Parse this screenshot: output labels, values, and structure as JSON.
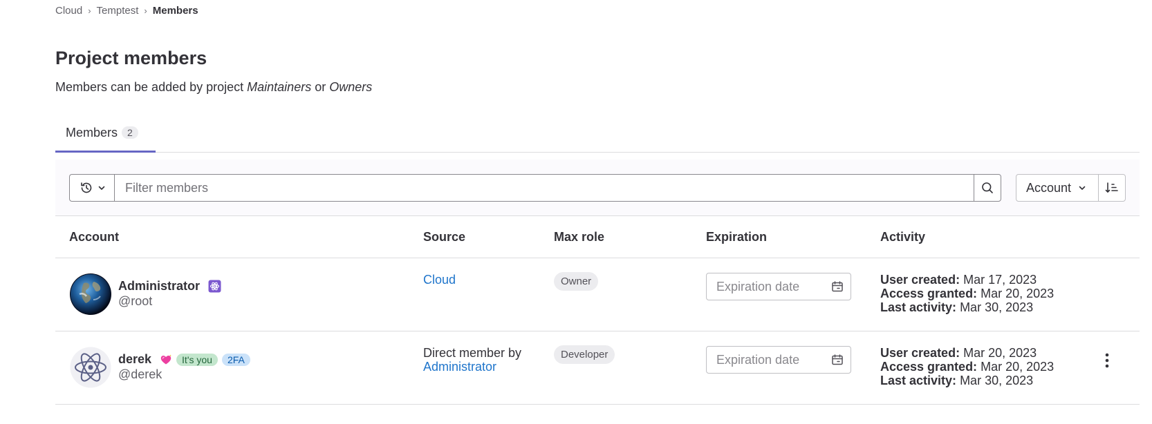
{
  "breadcrumb": {
    "items": [
      "Cloud",
      "Temptest",
      "Members"
    ],
    "separator": "›"
  },
  "page": {
    "title": "Project members",
    "description_prefix": "Members can be added by project ",
    "role_maintainers": "Maintainers",
    "description_or": " or ",
    "role_owners": "Owners"
  },
  "tabs": [
    {
      "label": "Members",
      "count": "2",
      "active": true
    }
  ],
  "filter": {
    "history_icon": "history-icon",
    "placeholder": "Filter members",
    "search_icon": "search-icon",
    "sort_label": "Account",
    "sort_direction_icon": "sort-ascending-icon"
  },
  "table": {
    "headers": {
      "account": "Account",
      "source": "Source",
      "max_role": "Max role",
      "expiration": "Expiration",
      "activity": "Activity"
    },
    "rows": [
      {
        "name": "Administrator",
        "username": "@root",
        "badge_icon": "admin-icon",
        "source": "Cloud",
        "max_role": "Owner",
        "expiration_placeholder": "Expiration date",
        "user_created_label": "User created:",
        "user_created": "Mar 17, 2023",
        "access_granted_label": "Access granted:",
        "access_granted": "Mar 20, 2023",
        "last_activity_label": "Last activity:",
        "last_activity": "Mar 30, 2023"
      },
      {
        "name": "derek",
        "username": "@derek",
        "status_icon": "sparkling-heart-icon",
        "badge_you": "It's you",
        "badge_2fa": "2FA",
        "source_prefix": "Direct member by",
        "source_link": "Administrator",
        "max_role": "Developer",
        "expiration_placeholder": "Expiration date",
        "user_created_label": "User created:",
        "user_created": "Mar 20, 2023",
        "access_granted_label": "Access granted:",
        "access_granted": "Mar 20, 2023",
        "last_activity_label": "Last activity:",
        "last_activity": "Mar 30, 2023",
        "actions_icon": "kebab-menu-icon"
      }
    ]
  },
  "colors": {
    "active_tab": "#6666c4",
    "link": "#1f75cb",
    "badge_you_bg": "#c3e6cd",
    "badge_2fa_bg": "#cbe2f9",
    "admin_badge": "#7b58cf"
  }
}
